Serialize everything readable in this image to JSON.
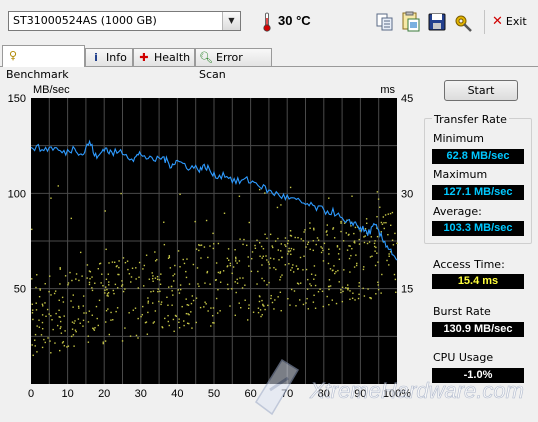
{
  "toolbar": {
    "drive": "ST31000524AS (1000 GB)",
    "temperature": "30 °C",
    "exit_label": "Exit",
    "icons": [
      "copy-info-icon",
      "copy-screenshot-icon",
      "save-icon",
      "options-icon"
    ]
  },
  "tabs": [
    {
      "label": "Benchmark",
      "icon": "benchmark-icon",
      "active": true
    },
    {
      "label": "Info",
      "icon": "info-icon",
      "active": false
    },
    {
      "label": "Health",
      "icon": "health-icon",
      "active": false
    },
    {
      "label": "Error Scan",
      "icon": "error-scan-icon",
      "active": false
    }
  ],
  "chart_data": {
    "type": "line",
    "ylabel": "MB/sec",
    "y2label": "ms",
    "ylim": [
      0,
      150
    ],
    "y2lim": [
      0,
      45
    ],
    "yticks": [
      "150",
      "100",
      "50"
    ],
    "y2ticks": [
      "45",
      "30",
      "15"
    ],
    "xticks": [
      "0",
      "10",
      "20",
      "30",
      "40",
      "50",
      "60",
      "70",
      "80",
      "90",
      "100%"
    ],
    "xlim": [
      0,
      100
    ],
    "grid": true,
    "background": "#000000",
    "grid_color": "#4a4a4a",
    "series": [
      {
        "type": "line",
        "color": "#2e9bff",
        "x": [
          0,
          3,
          6,
          9,
          12,
          14,
          16,
          18,
          20,
          22,
          25,
          28,
          30,
          33,
          36,
          38,
          40,
          43,
          46,
          48,
          50,
          53,
          56,
          59,
          62,
          65,
          68,
          71,
          74,
          77,
          80,
          83,
          86,
          88,
          90,
          92,
          94,
          96,
          98,
          100
        ],
        "y": [
          125,
          123,
          124,
          121,
          124,
          120,
          127,
          118,
          124,
          121,
          122,
          118,
          121,
          117,
          119,
          115,
          117,
          114,
          113,
          114,
          109,
          110,
          106,
          107,
          105,
          101,
          99,
          97,
          95,
          93,
          91,
          90,
          84,
          85,
          82,
          79,
          83,
          76,
          71,
          65
        ]
      },
      {
        "type": "scatter",
        "color": "#c8c848",
        "note_style": "access-time",
        "density": 700
      }
    ]
  },
  "controls": {
    "start_label": "Start"
  },
  "transfer_rate": {
    "title": "Transfer Rate",
    "minimum_label": "Minimum",
    "minimum_value": "62.8 MB/sec",
    "maximum_label": "Maximum",
    "maximum_value": "127.1 MB/sec",
    "average_label": "Average:",
    "average_value": "103.3 MB/sec"
  },
  "access_time": {
    "label": "Access Time:",
    "value": "15.4 ms"
  },
  "burst_rate": {
    "label": "Burst Rate",
    "value": "130.9 MB/sec"
  },
  "cpu_usage": {
    "label": "CPU Usage",
    "value": "-1.0%"
  },
  "watermark": "XtremeHardware.com"
}
